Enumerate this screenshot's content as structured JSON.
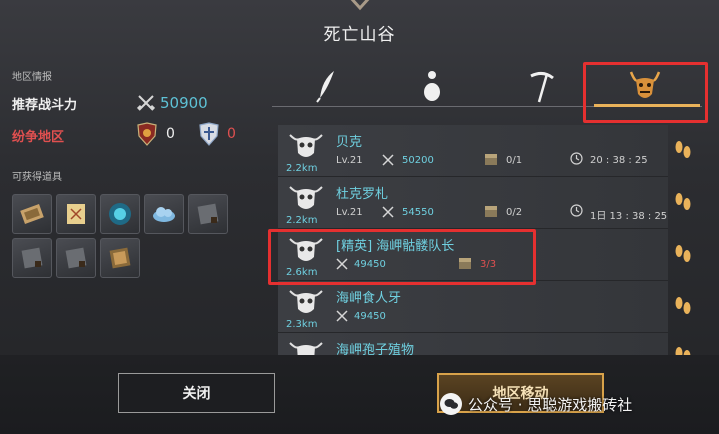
{
  "title": "死亡山谷",
  "left_panel": {
    "region_info_label": "地区情报",
    "power_label": "推荐战斗力",
    "power_value": "50900",
    "dispute_label": "纷争地区",
    "faction_red_count": "0",
    "faction_blue_count": "0",
    "items_label": "可获得道具",
    "items": [
      "scroll-map-icon",
      "treasure-map-icon",
      "blue-orb-icon",
      "cloud-icon",
      "gray-box-icon",
      "gray-box-icon",
      "gray-box-icon",
      "bronze-box-icon"
    ]
  },
  "tabs": [
    "feather-icon",
    "figure-icon",
    "scythe-icon",
    "demon-mask-icon"
  ],
  "entries": [
    {
      "name": "贝克",
      "distance": "2.2km",
      "level": "Lv.21",
      "power": "50200",
      "count": "0/1",
      "time": "20 : 38 : 25",
      "elite": false
    },
    {
      "name": "杜克罗札",
      "distance": "2.2km",
      "level": "Lv.21",
      "power": "54550",
      "count": "0/2",
      "time": "1日 13 : 38 : 25",
      "elite": false
    },
    {
      "name": "[精英] 海岬骷髅队长",
      "distance": "2.6km",
      "level": "",
      "power": "49450",
      "count": "3/3",
      "time": "",
      "elite": true
    },
    {
      "name": "海岬食人牙",
      "distance": "2.3km",
      "level": "",
      "power": "49450",
      "count": "",
      "time": "",
      "elite": false
    },
    {
      "name": "海岬孢子殖物",
      "distance": "",
      "level": "",
      "power": "",
      "count": "",
      "time": "",
      "elite": false
    }
  ],
  "buttons": {
    "close": "关闭",
    "move": "地区移动"
  },
  "watermark": "公众号 · 思聪游戏搬砖社",
  "colors": {
    "accent_cyan": "#6fd0e0",
    "gold": "#e9b25a",
    "highlight_red": "#e53030"
  }
}
